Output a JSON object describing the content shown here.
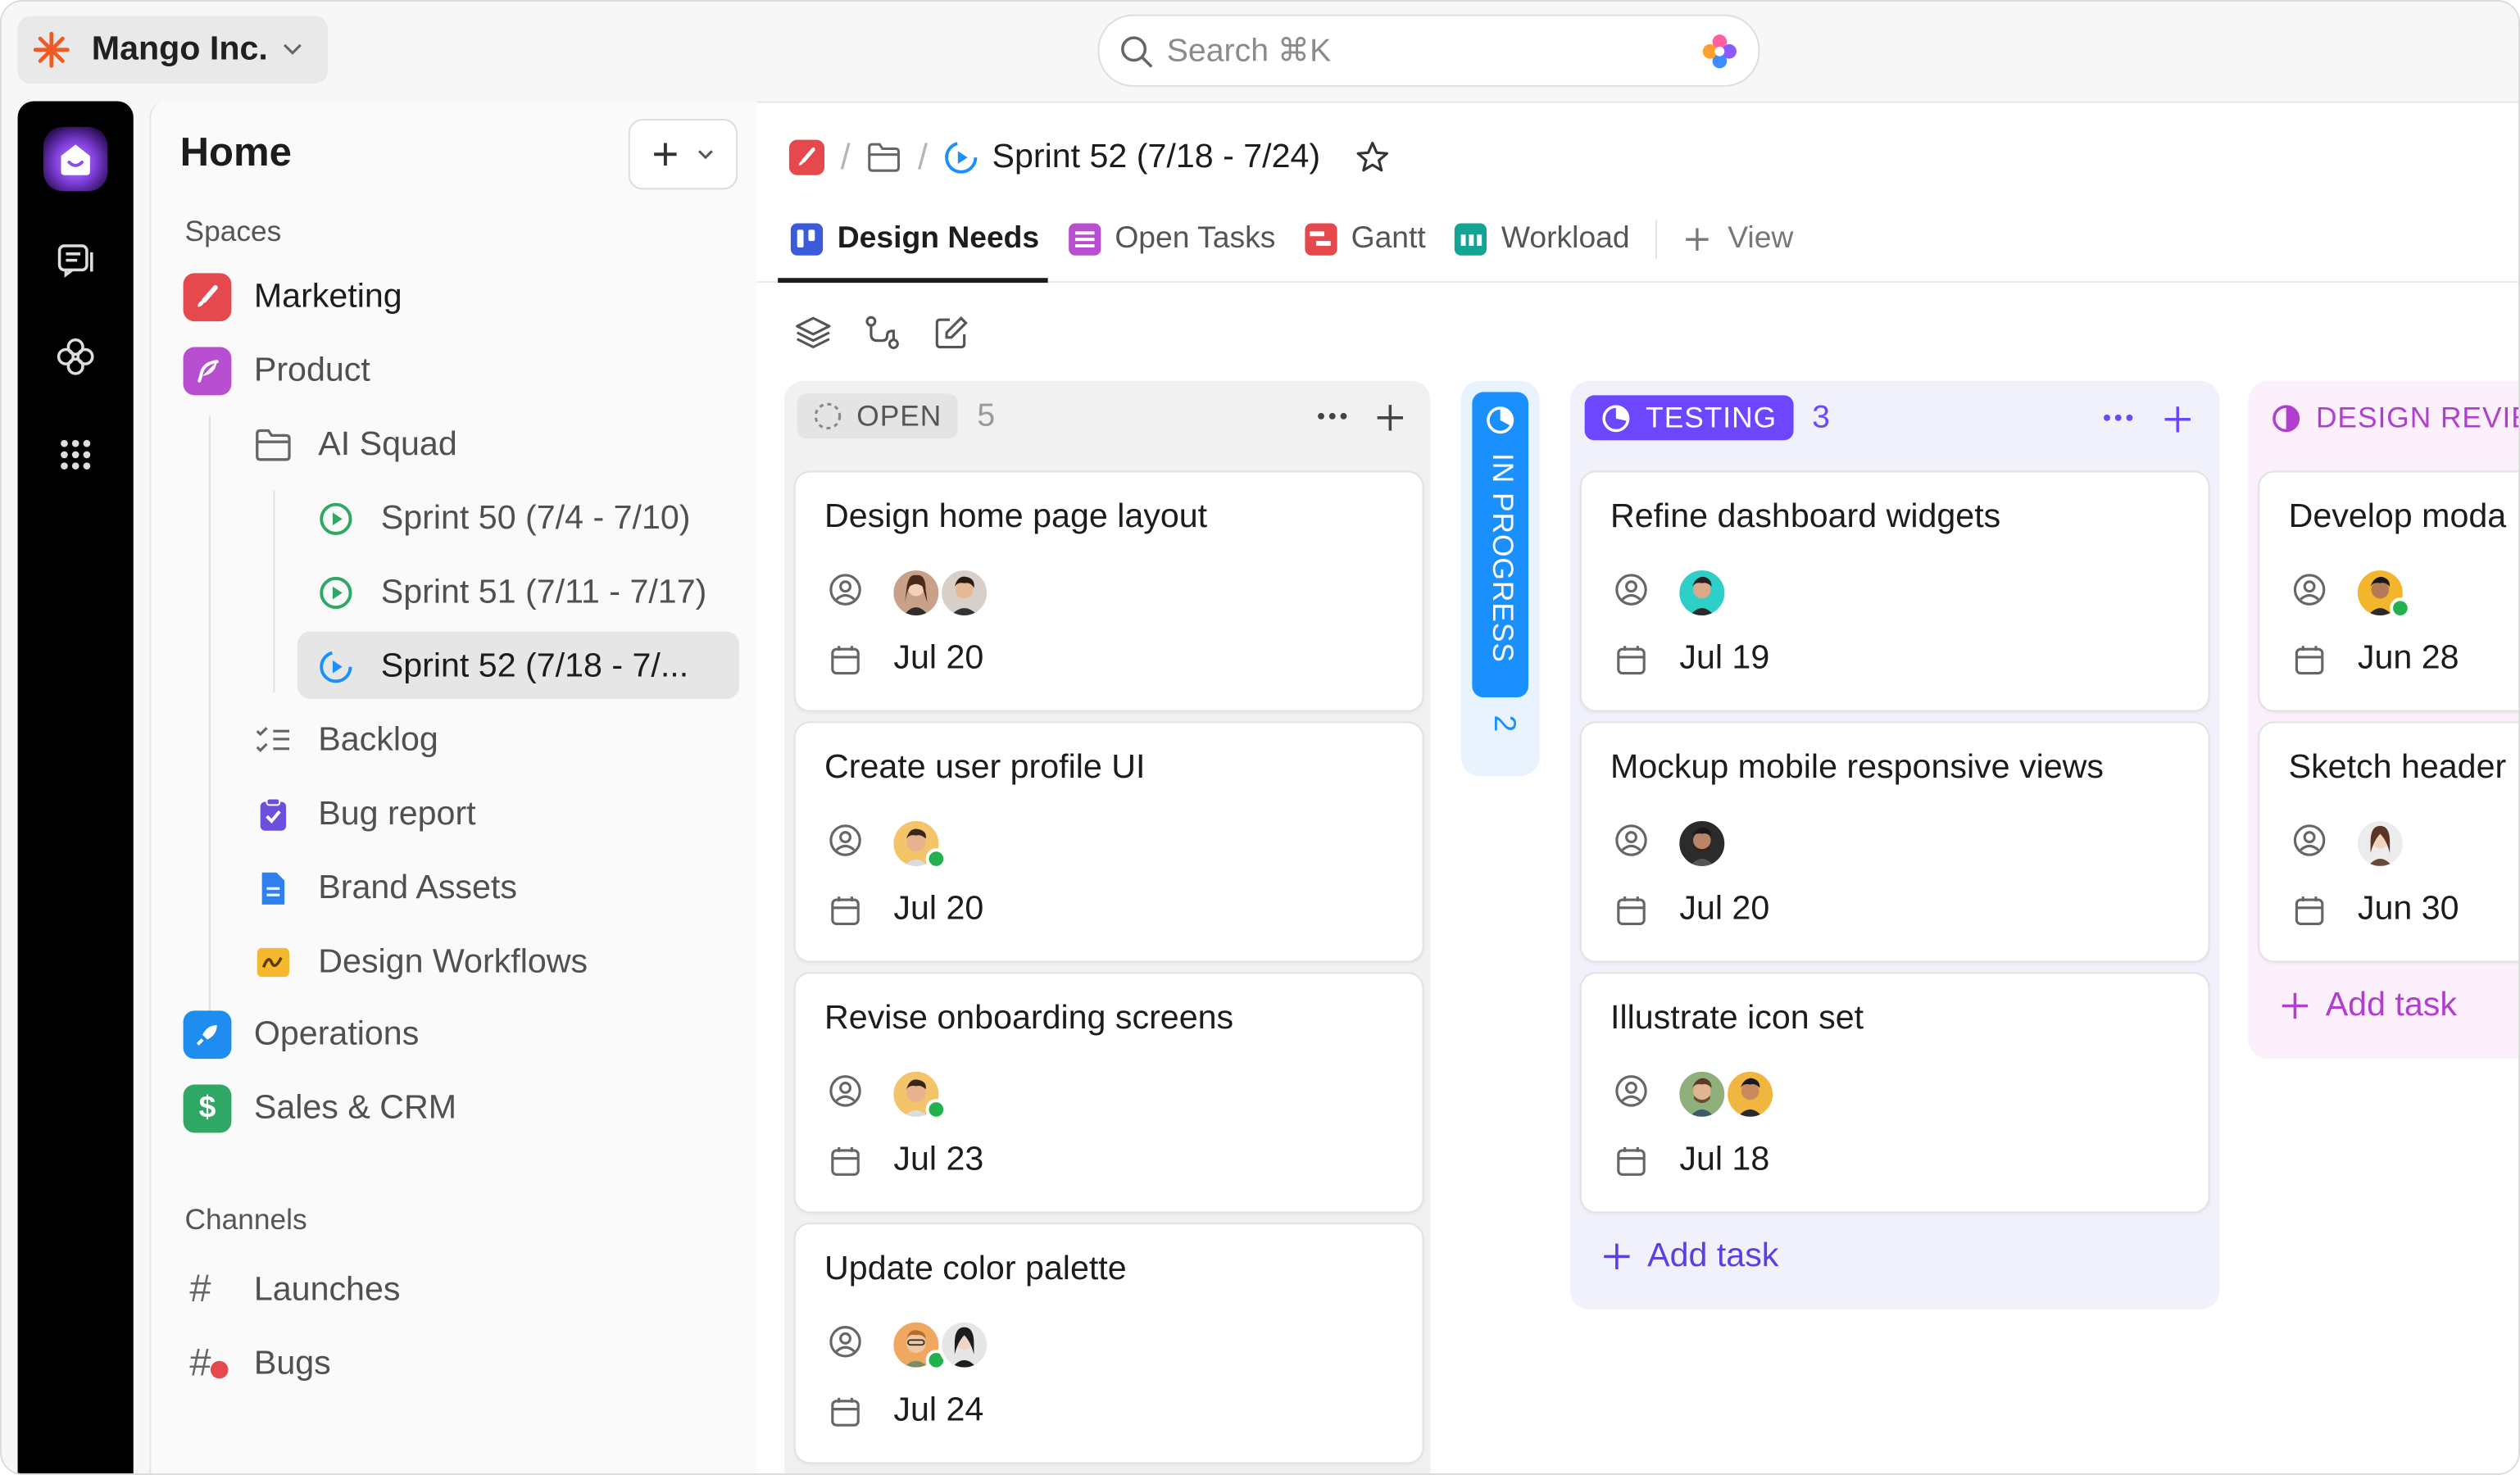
{
  "workspace": {
    "name": "Mango Inc."
  },
  "search": {
    "placeholder": "Search ⌘K"
  },
  "sidebar": {
    "title": "Home",
    "spaces_heading": "Spaces",
    "spaces": [
      {
        "label": "Marketing",
        "color": "#e5484d",
        "icon": "brush-icon"
      },
      {
        "label": "Product",
        "color": "#b84fd1",
        "icon": "feather-icon"
      }
    ],
    "folder": {
      "label": "AI Squad"
    },
    "sprints": [
      {
        "label": "Sprint 50 (7/4 - 7/10)"
      },
      {
        "label": "Sprint 51 (7/11 - 7/17)"
      },
      {
        "label": "Sprint 52 (7/18 - 7/..."
      }
    ],
    "lists": [
      {
        "label": "Backlog",
        "icon": "checklist-icon"
      },
      {
        "label": "Bug report",
        "icon": "clipboard-check-icon",
        "color": "#6d4fe0"
      },
      {
        "label": "Brand Assets",
        "icon": "document-icon",
        "color": "#2f80ed"
      },
      {
        "label": "Design Workflows",
        "icon": "whiteboard-icon",
        "color": "#f5b82e"
      }
    ],
    "more_spaces": [
      {
        "label": "Operations",
        "color": "#1f8cf0",
        "icon": "rocket-icon"
      },
      {
        "label": "Sales & CRM",
        "color": "#2fa866",
        "icon": "dollar-icon"
      }
    ],
    "channels_heading": "Channels",
    "channels": [
      {
        "label": "Launches"
      },
      {
        "label": "Bugs"
      }
    ]
  },
  "header": {
    "breadcrumb_title": "Sprint 52 (7/18 - 7/24)"
  },
  "tabs": [
    {
      "label": "Design Needs",
      "color": "#3b5bdb",
      "active": true
    },
    {
      "label": "Open Tasks",
      "color": "#b84fd1"
    },
    {
      "label": "Gantt",
      "color": "#e5484d"
    },
    {
      "label": "Workload",
      "color": "#12a594"
    },
    {
      "label": "View"
    }
  ],
  "board": {
    "open": {
      "label": "OPEN",
      "count": "5",
      "cards": [
        {
          "title": "Design home page layout",
          "date": "Jul 20"
        },
        {
          "title": "Create user profile UI",
          "date": "Jul 20"
        },
        {
          "title": "Revise onboarding screens",
          "date": "Jul 23"
        },
        {
          "title": "Update color palette",
          "date": "Jul 24"
        }
      ]
    },
    "in_progress": {
      "label": "IN PROGRESS",
      "count": "2",
      "color": "#1a90ff"
    },
    "testing": {
      "label": "TESTING",
      "count": "3",
      "color": "#6c47ff",
      "cards": [
        {
          "title": "Refine dashboard widgets",
          "date": "Jul 19"
        },
        {
          "title": "Mockup mobile responsive views",
          "date": "Jul 20"
        },
        {
          "title": "Illustrate icon set",
          "date": "Jul 18"
        }
      ],
      "add_task": "Add task"
    },
    "design_review": {
      "label": "DESIGN REVIE",
      "color": "#b03ecf",
      "cards": [
        {
          "title": "Develop moda",
          "date": "Jun 28"
        },
        {
          "title": "Sketch header",
          "date": "Jun 30"
        }
      ],
      "add_task": "Add task"
    }
  }
}
